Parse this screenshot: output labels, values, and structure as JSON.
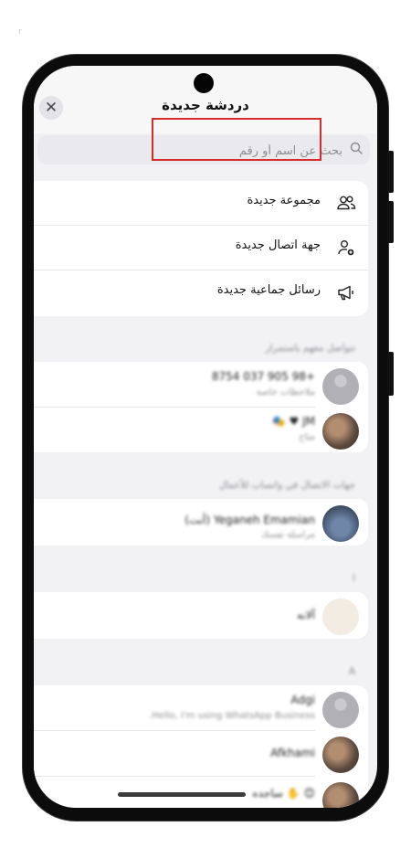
{
  "header": {
    "title": "دردشة جديدة",
    "close_icon": "close-icon"
  },
  "search": {
    "placeholder": "بحث عن اسم أو رقم",
    "icon": "search-icon"
  },
  "menu": [
    {
      "label": "مجموعة جديدة",
      "icon": "group-icon",
      "highlighted": true
    },
    {
      "label": "جهة اتصال جديدة",
      "icon": "add-contact-icon",
      "highlighted": false
    },
    {
      "label": "رسائل جماعية جديدة",
      "icon": "broadcast-icon",
      "highlighted": false
    }
  ],
  "sections": {
    "frequent": "تتواصل معهم باستمرار",
    "on_whatsapp": "جهات الاتصال في واتساب للأعمال",
    "letter_1": "ا",
    "letter_2": "A"
  },
  "contacts": {
    "frequent": [
      {
        "name": "+98 905 037 8754",
        "status": "ملاحظات خاصة",
        "avatar": "default-avatar"
      },
      {
        "name": "JM ♥ 🎭",
        "status": "متاح",
        "avatar": "photo-avatar"
      }
    ],
    "on_whatsapp": [
      {
        "name": "Yeganeh Emamian (أنت)",
        "status": "مراسلة نفسك",
        "avatar": "photo-avatar"
      }
    ],
    "letter_1": [
      {
        "name": "آلانه",
        "status": "",
        "avatar": "logo-avatar"
      }
    ],
    "letter_2": [
      {
        "name": "Adgi",
        "status": "Hello, I'm using WhatsApp Business.",
        "avatar": "default-avatar"
      },
      {
        "name": "Afkhami",
        "status": "",
        "avatar": "photo-avatar"
      },
      {
        "name": "😊 ✋ ساجده",
        "status": "",
        "avatar": "photo-avatar"
      }
    ]
  },
  "colors": {
    "highlight_border": "#d62c2c",
    "background": "#f2f2f5",
    "card": "#ffffff"
  }
}
